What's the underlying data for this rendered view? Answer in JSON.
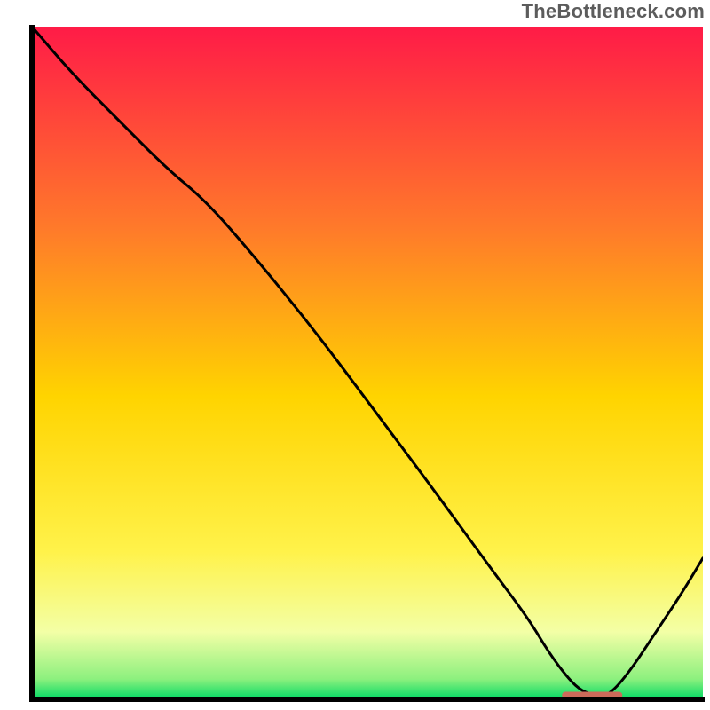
{
  "watermark": "TheBottleneck.com",
  "chart_data": {
    "type": "line",
    "title": "",
    "xlabel": "",
    "ylabel": "",
    "xlim": [
      0,
      100
    ],
    "ylim": [
      0,
      100
    ],
    "grid": false,
    "legend": false,
    "gradient_stops": [
      {
        "offset": 0,
        "color": "#ff1b47"
      },
      {
        "offset": 30,
        "color": "#ff7a2a"
      },
      {
        "offset": 55,
        "color": "#ffd400"
      },
      {
        "offset": 78,
        "color": "#fff24a"
      },
      {
        "offset": 90,
        "color": "#f3ffa6"
      },
      {
        "offset": 97,
        "color": "#8cf07e"
      },
      {
        "offset": 100,
        "color": "#00d964"
      }
    ],
    "series": [
      {
        "name": "curve",
        "x": [
          0,
          6,
          13,
          20,
          26,
          33,
          42,
          51,
          60,
          68,
          74,
          77,
          80,
          82,
          84,
          86,
          89,
          93,
          97,
          100
        ],
        "y": [
          100,
          93,
          86,
          79,
          74,
          66,
          55,
          43,
          31,
          20,
          12,
          7,
          3,
          1.2,
          0.6,
          0.6,
          4,
          10,
          16,
          21
        ]
      }
    ],
    "highlight_segment": {
      "x_start": 79,
      "x_end": 88,
      "y": 0.6,
      "color": "#cc6a5a"
    },
    "axis_color": "#000000",
    "axis_width": 6,
    "line_color": "#000000",
    "line_width": 3
  }
}
